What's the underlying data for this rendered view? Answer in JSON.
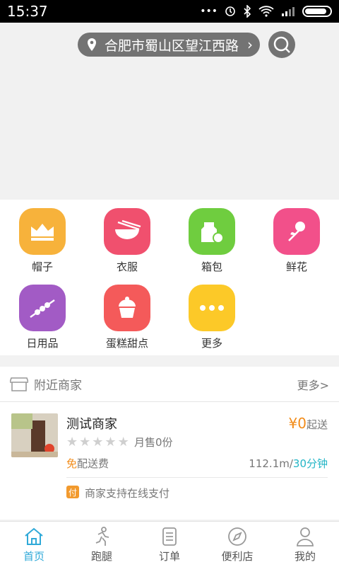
{
  "status_bar": {
    "time": "15:37",
    "indicators": [
      "...",
      "alarm",
      "bluetooth",
      "wifi",
      "signal",
      "battery"
    ]
  },
  "header": {
    "location": "合肥市蜀山区望江西路",
    "location_icon": "location-pin-icon",
    "search_icon": "search-icon"
  },
  "categories": [
    {
      "label": "帽子",
      "icon": "crown-icon",
      "color": "#f7b23b"
    },
    {
      "label": "衣服",
      "icon": "bowl-chopsticks-icon",
      "color": "#f0506e"
    },
    {
      "label": "箱包",
      "icon": "milk-carton-apple-icon",
      "color": "#6fcd3f"
    },
    {
      "label": "鲜花",
      "icon": "flower-icon",
      "color": "#f2508a"
    },
    {
      "label": "日用品",
      "icon": "skewers-icon",
      "color": "#a25bc5"
    },
    {
      "label": "蛋糕甜点",
      "icon": "cupcake-icon",
      "color": "#f45a5a"
    },
    {
      "label": "更多",
      "icon": "more-dots-icon",
      "color": "#fcc928"
    }
  ],
  "nearby": {
    "title": "附近商家",
    "more": "更多>"
  },
  "shop": {
    "name": "测试商家",
    "min_price_symbol": "¥0",
    "min_price_suffix": "起送",
    "rating": 0,
    "rating_max": 5,
    "monthly_sales": "月售0份",
    "free_delivery_prefix": "免",
    "free_delivery_suffix": "配送费",
    "distance": "112.1m/",
    "delivery_time": "30分钟",
    "pay_badge": "付",
    "pay_text": "商家支持在线支付"
  },
  "tabs": [
    {
      "label": "首页",
      "icon": "home-icon",
      "active": true
    },
    {
      "label": "跑腿",
      "icon": "runner-icon",
      "active": false
    },
    {
      "label": "订单",
      "icon": "order-list-icon",
      "active": false
    },
    {
      "label": "便利店",
      "icon": "compass-icon",
      "active": false
    },
    {
      "label": "我的",
      "icon": "user-icon",
      "active": false
    }
  ],
  "colors": {
    "accent": "#2fa9d8",
    "price": "#f28c1a",
    "time": "#23b5c6",
    "pill": "#737373"
  }
}
